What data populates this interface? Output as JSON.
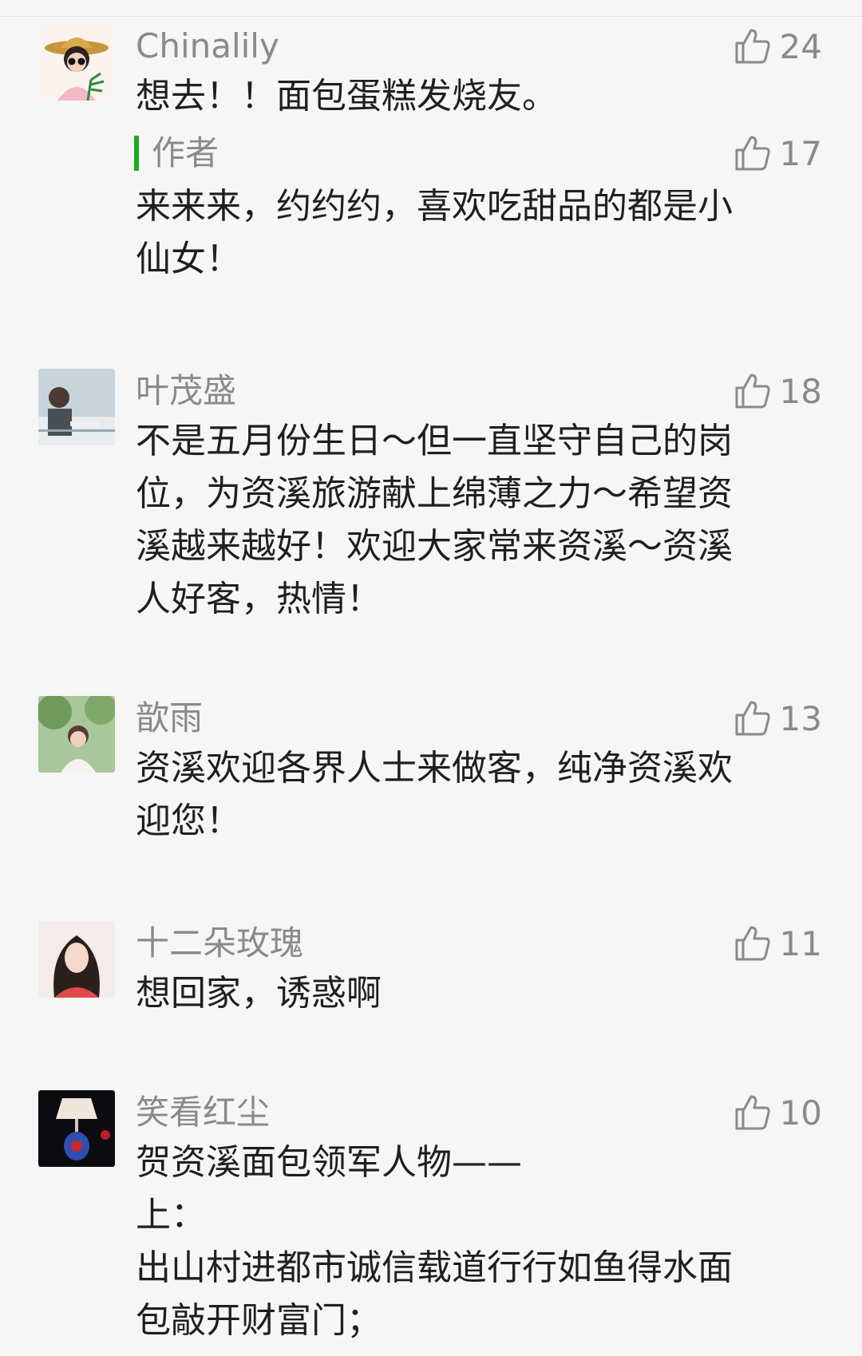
{
  "comments": [
    {
      "name": "Chinalily",
      "likes": "24",
      "text": "想去！！面包蛋糕发烧友。",
      "reply": {
        "label": "作者",
        "likes": "17",
        "text": "来来来，约约约，喜欢吃甜品的都是小\n仙女！"
      }
    },
    {
      "name": "叶茂盛",
      "likes": "18",
      "text": "不是五月份生日～但一直坚守自己的岗\n位，为资溪旅游献上绵薄之力～希望资\n溪越来越好！欢迎大家常来资溪～资溪\n人好客，热情！"
    },
    {
      "name": "歆雨",
      "likes": "13",
      "text": "资溪欢迎各界人士来做客，纯净资溪欢\n迎您！"
    },
    {
      "name": "十二朵玫瑰",
      "likes": "11",
      "text": "想回家，诱惑啊"
    },
    {
      "name": "笑看红尘",
      "likes": "10",
      "text": "贺资溪面包领军人物——\n上：\n出山村进都市诚信载道行行如鱼得水面\n包敲开财富门；"
    }
  ],
  "colors": {
    "background": "#f6f6f6",
    "author_accent": "#1aad19",
    "secondary_text": "#8a8a8a",
    "primary_text": "#1f1f1f"
  },
  "icons": {
    "like": "thumbs-up-icon"
  }
}
